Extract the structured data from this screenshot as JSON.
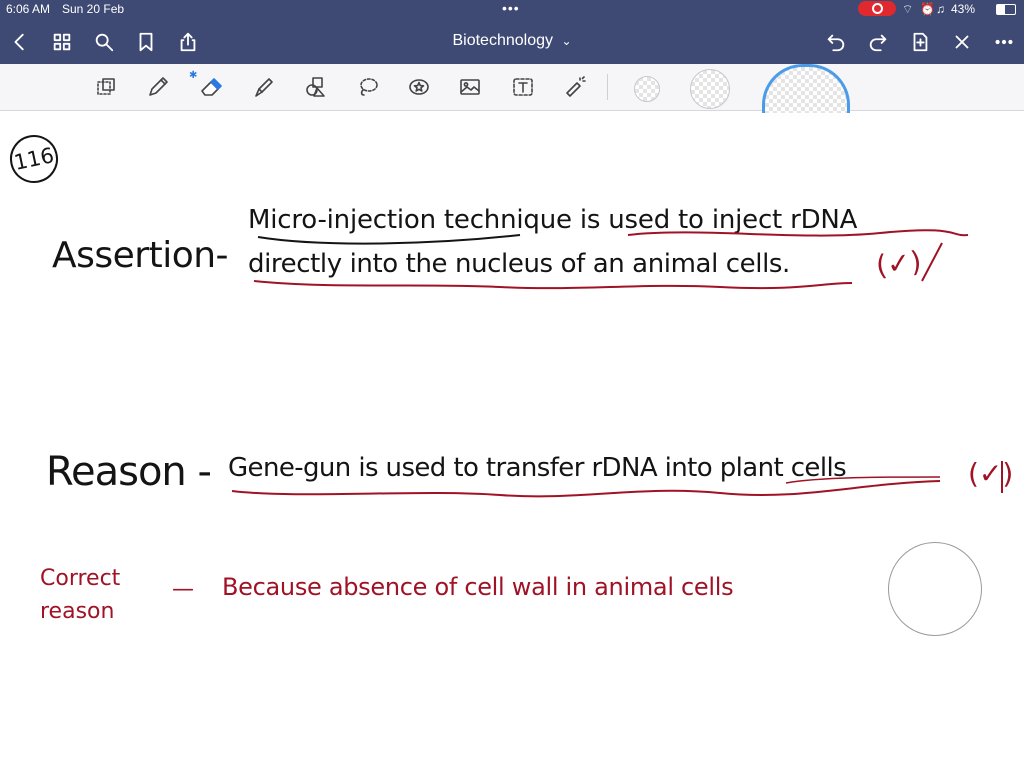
{
  "status_bar": {
    "time": "6:06 AM",
    "date": "Sun 20 Feb",
    "battery": "43%"
  },
  "nav": {
    "title": "Biotechnology",
    "title_chevron": "⌄"
  },
  "toolbar": {
    "tools": [
      "lasso-select-icon",
      "pen-icon",
      "eraser-icon",
      "highlighter-icon",
      "shapes-icon",
      "lasso-icon",
      "sticker-icon",
      "image-icon",
      "text-icon",
      "laser-pointer-icon"
    ],
    "stroke_options": [
      "small-stroke",
      "medium-stroke",
      "large-stroke"
    ]
  },
  "note": {
    "question_number": "116",
    "assertion_label": "Assertion-",
    "assertion_line1": "Micro-injection technique is used to inject rDNA",
    "assertion_line2": "directly into the nucleus of an animal cells.",
    "assertion_mark": "(✓)",
    "reason_label": "Reason -",
    "reason_text": "Gene-gun is used to transfer rDNA into plant cells",
    "reason_mark": "(✓)",
    "correct_reason_label_1": "Correct",
    "correct_reason_label_2": "reason",
    "correct_reason_dash": "—",
    "correct_reason_text": "Because absence of cell wall in animal cells"
  },
  "colors": {
    "nav_bar": "#3e4a73",
    "ink_black": "#141414",
    "ink_red": "#a01226"
  }
}
